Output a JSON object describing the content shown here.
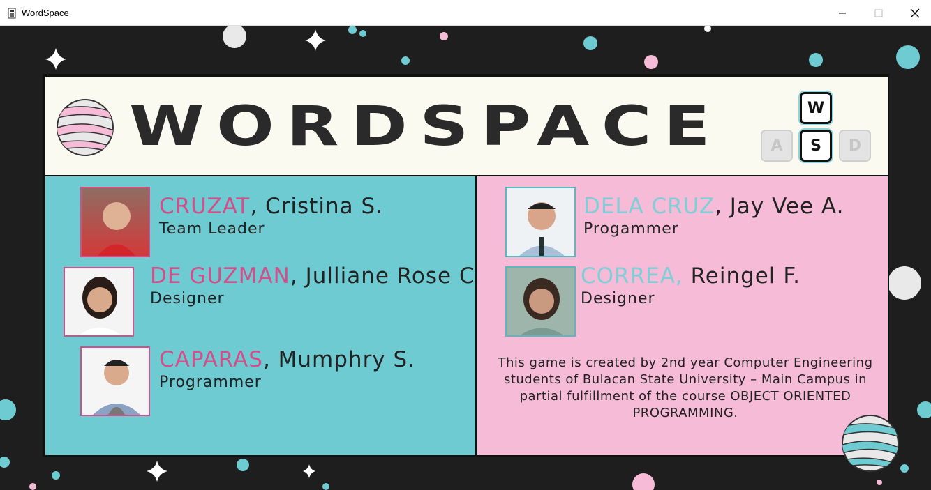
{
  "window": {
    "title": "WordSpace"
  },
  "header": {
    "logo_text": "WORDSPACE",
    "keys": {
      "w": "W",
      "a": "A",
      "s": "S",
      "d": "D"
    }
  },
  "team": {
    "left": [
      {
        "surname": "CRUZAT",
        "given": ", Cristina S.",
        "role": "Team Leader"
      },
      {
        "surname": "DE GUZMAN",
        "given": ", Julliane Rose C.",
        "role": "Designer"
      },
      {
        "surname": "CAPARAS",
        "given": ", Mumphry S.",
        "role": "Programmer"
      }
    ],
    "right": [
      {
        "surname": "DELA CRUZ",
        "given": ", Jay Vee A.",
        "role": "Progammer"
      },
      {
        "surname": "CORREA,",
        "given": " Reingel F.",
        "role": "Designer"
      }
    ]
  },
  "credits": "This game is created by 2nd year Computer Engineering students of Bulacan State University – Main Campus in partial fulfillment of the course OBJECT ORIENTED PROGRAMMING.",
  "colors": {
    "left_panel": "#6ecbd2",
    "right_panel": "#f6bbd6",
    "header": "#fbfaf0",
    "surname_pink": "#d1508a",
    "surname_blue": "#7fcfd8",
    "background": "#1e1e1e"
  },
  "icons": [
    "app-icon",
    "minimize-icon",
    "maximize-icon",
    "close-icon",
    "planet-icon"
  ]
}
